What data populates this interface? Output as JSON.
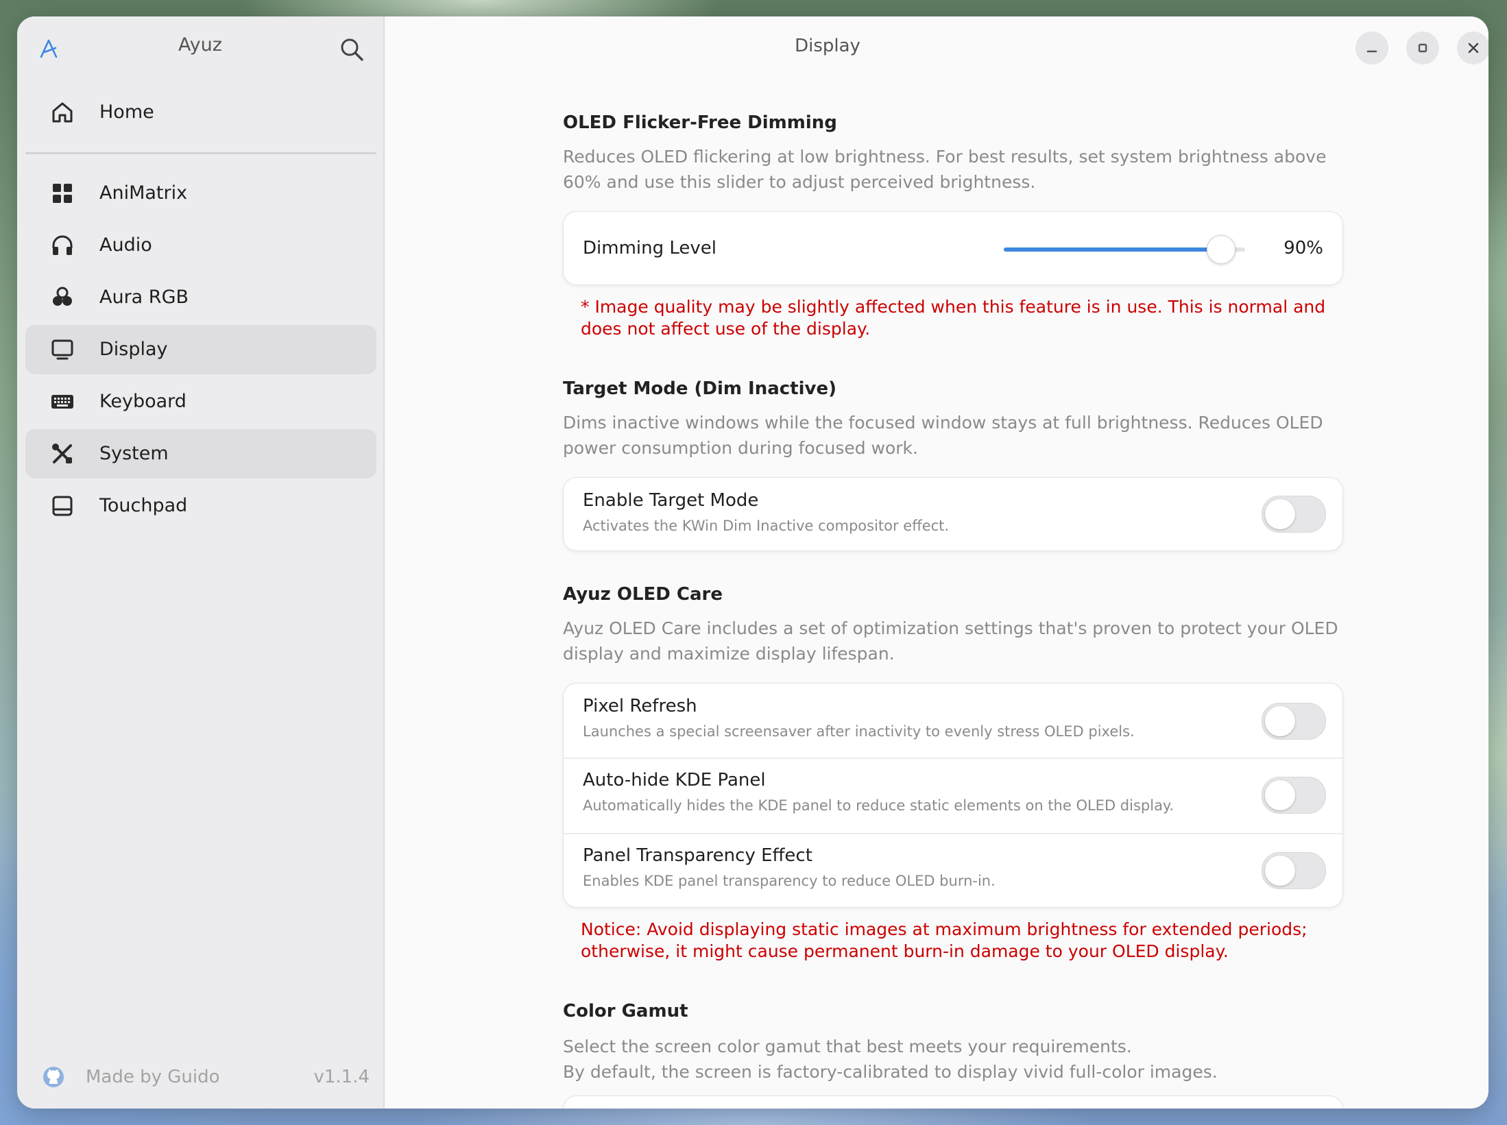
{
  "app": {
    "title": "Ayuz"
  },
  "sidebar": {
    "home": {
      "label": "Home",
      "icon": "home-icon"
    },
    "items": [
      {
        "label": "AniMatrix",
        "icon": "grid-icon",
        "active": false
      },
      {
        "label": "Audio",
        "icon": "headphones-icon",
        "active": false
      },
      {
        "label": "Aura RGB",
        "icon": "rgb-circles-icon",
        "active": false
      },
      {
        "label": "Display",
        "icon": "monitor-icon",
        "active": true
      },
      {
        "label": "Keyboard",
        "icon": "keyboard-icon",
        "active": false
      },
      {
        "label": "System",
        "icon": "tools-icon",
        "active": true
      },
      {
        "label": "Touchpad",
        "icon": "touchpad-icon",
        "active": false
      }
    ],
    "footer": {
      "made_by": "Made by Guido",
      "version": "v1.1.4"
    }
  },
  "header": {
    "title": "Display"
  },
  "colors": {
    "accent": "#3e86e0",
    "warning": "#cc0000"
  },
  "sections": {
    "dimming": {
      "title": "OLED Flicker-Free Dimming",
      "desc": "Reduces OLED flickering at low brightness. For best results, set system brightness above 60% and use this slider to adjust perceived brightness.",
      "label": "Dimming Level",
      "value": 90,
      "value_text": "90%",
      "warning": "* Image quality may be slightly affected when this feature is in use. This is normal and does not affect use of the display."
    },
    "target": {
      "title": "Target Mode (Dim Inactive)",
      "desc": "Dims inactive windows while the focused window stays at full brightness. Reduces OLED power consumption during focused work.",
      "row": {
        "title": "Enable Target Mode",
        "sub": "Activates the KWin Dim Inactive compositor effect.",
        "enabled": false
      }
    },
    "care": {
      "title": "Ayuz OLED Care",
      "desc": "Ayuz OLED Care includes a set of optimization settings that's proven to protect your OLED display and maximize display lifespan.",
      "rows": [
        {
          "title": "Pixel Refresh",
          "sub": "Launches a special screensaver after inactivity to evenly stress OLED pixels.",
          "enabled": false
        },
        {
          "title": "Auto-hide KDE Panel",
          "sub": "Automatically hides the KDE panel to reduce static elements on the OLED display.",
          "enabled": false
        },
        {
          "title": "Panel Transparency Effect",
          "sub": "Enables KDE panel transparency to reduce OLED burn-in.",
          "enabled": false
        }
      ],
      "notice": "Notice: Avoid displaying static images at maximum brightness for extended periods; otherwise, it might cause permanent burn-in damage to your OLED display."
    },
    "gamut": {
      "title": "Color Gamut",
      "desc_line1": "Select the screen color gamut that best meets your requirements.",
      "desc_line2": "By default, the screen is factory-calibrated to display vivid full-color images."
    }
  }
}
